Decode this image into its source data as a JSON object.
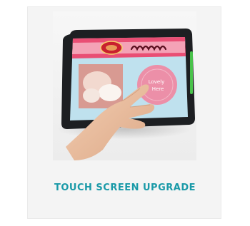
{
  "card": {
    "title": "TOUCH SCREEN UPGRADE",
    "title_color": "#1a9aa8",
    "image": {
      "icon": "touch-screen-tablet-image",
      "screen_header_text": "مذاقه فورك مع",
      "screen_bubble_text": "Lovely Here"
    }
  }
}
